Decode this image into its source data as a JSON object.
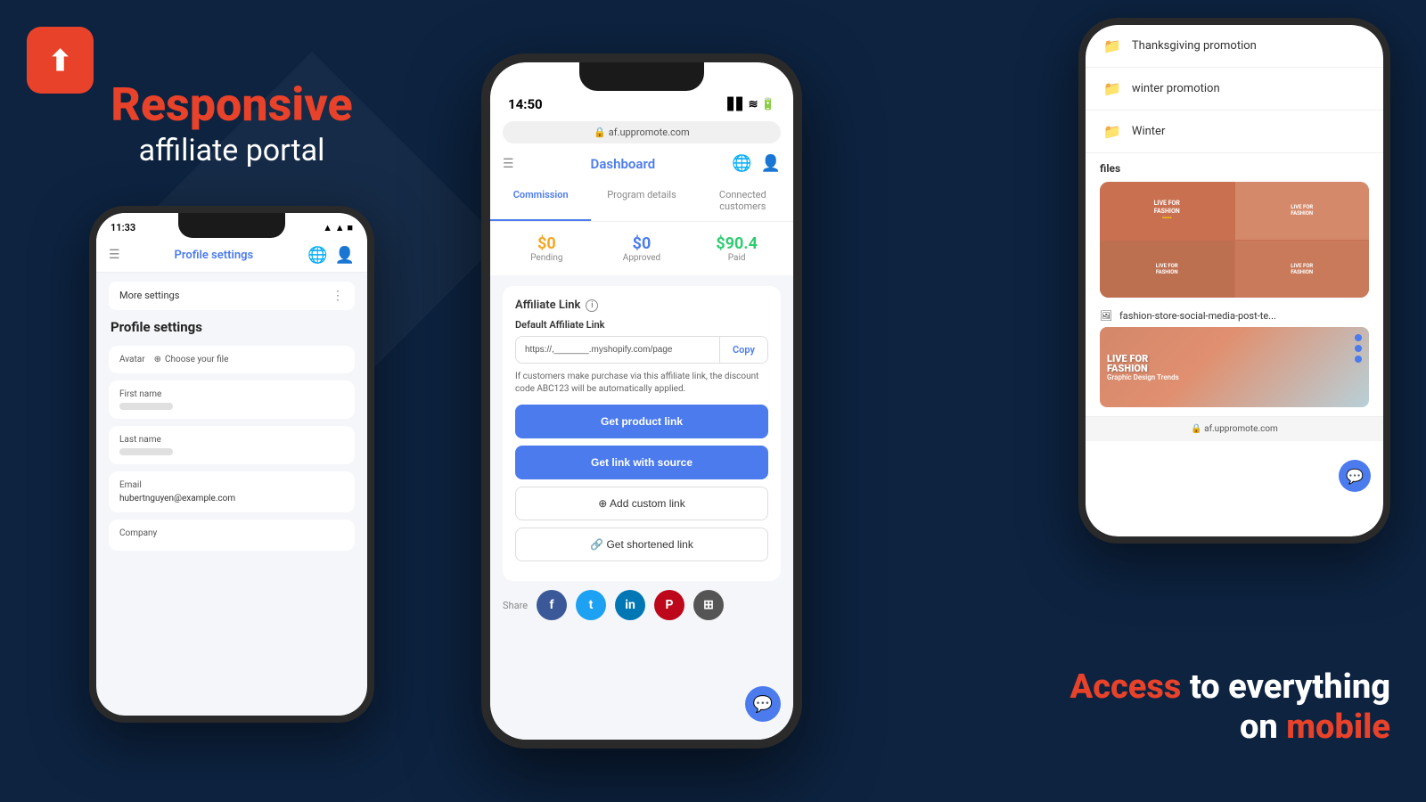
{
  "logo": {
    "icon": "↑",
    "alt": "UpPromote Logo"
  },
  "left": {
    "headline_red": "Responsive",
    "headline_white": "affiliate portal"
  },
  "left_phone": {
    "time": "11:33",
    "header_title": "Profile settings",
    "more_settings": "More settings",
    "profile_settings_title": "Profile settings",
    "avatar_label": "Avatar",
    "avatar_choose": "Choose your file",
    "first_name_label": "First name",
    "last_name_label": "Last name",
    "email_label": "Email",
    "email_value": "hubertnguyen@example.com",
    "company_label": "Company"
  },
  "center_phone": {
    "time": "14:50",
    "url": "af.uppromote.com",
    "header_title": "Dashboard",
    "tab_commission": "Commission",
    "tab_program": "Program details",
    "tab_connected": "Connected customers",
    "pending_value": "$0",
    "pending_label": "Pending",
    "approved_value": "$0",
    "approved_label": "Approved",
    "paid_value": "$90.4",
    "paid_label": "Paid",
    "affiliate_link_title": "Affiliate Link",
    "default_link_label": "Default Affiliate Link",
    "link_url": "https://,_______.myshopify.com/page",
    "copy_label": "Copy",
    "link_note": "If customers make purchase via this affiliate link, the discount code ABC123 will be automatically applied.",
    "btn_product_link": "Get product link",
    "btn_link_source": "Get link with source",
    "btn_custom": "Add custom link",
    "btn_shortened": "Get shortened link",
    "share_label": "Share"
  },
  "right_phone": {
    "folder1": "Thanksgiving promotion",
    "folder2": "winter promotion",
    "folder3": "Winter",
    "files_title": "files",
    "file_image_name": "fashion-store-social-media-post-te...",
    "url": "af.uppromote.com"
  },
  "bottom_right": {
    "access_text": "Access",
    "to_everything": "to everything",
    "on_text": "on",
    "mobile_text": "mobile"
  }
}
